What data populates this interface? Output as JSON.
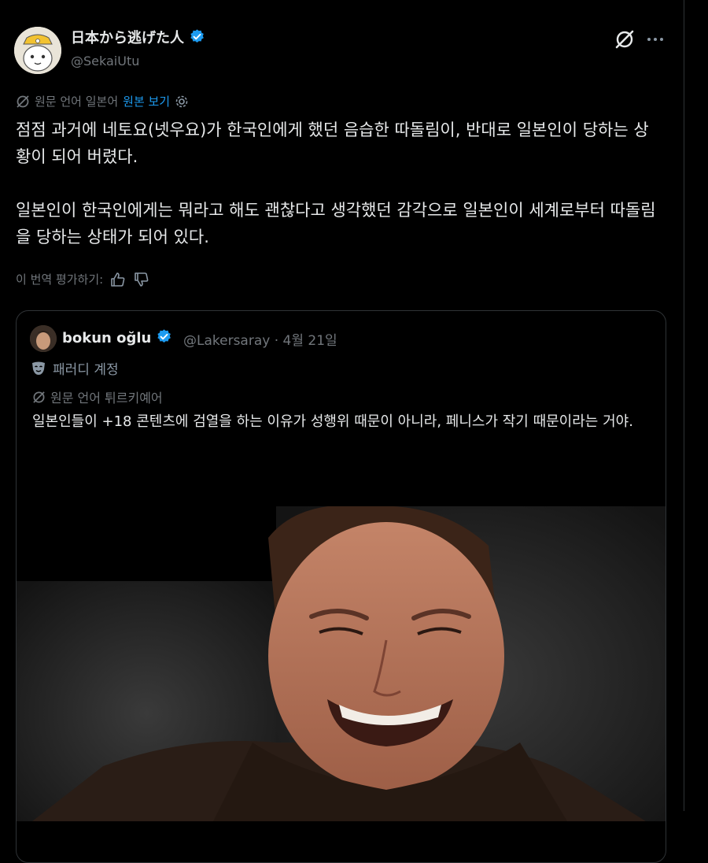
{
  "author": {
    "display_name": "日本から逃げた人",
    "handle": "@SekaiUtu"
  },
  "translation": {
    "source_lang": "원문 언어 일본어",
    "show_original": "원본 보기"
  },
  "post": {
    "paragraphs": [
      "점점 과거에 네토요(넷우요)가 한국인에게 했던 음습한 따돌림이, 반대로 일본인이 당하는 상황이 되어 버렸다.",
      "일본인이 한국인에게는 뭐라고 해도 괜찮다고 생각했던 감각으로 일본인이 세계로부터 따돌림을 당하는 상태가 되어 있다."
    ]
  },
  "rating": {
    "label": "이 번역 평가하기:"
  },
  "quote": {
    "display_name": "bokun oğlu",
    "meta": "@Lakersaray · 4월 21일",
    "parody_label": "패러디 계정",
    "source_lang": "원문 언어 튀르키예어",
    "text": "일본인들이 +18 콘텐츠에 검열을 하는 이유가 성행위 때문이 아니라, 페니스가 작기 때문이라는 거야."
  },
  "colors": {
    "accent": "#1d9bf0",
    "secondary_text": "#71767b",
    "border": "#2f3336"
  },
  "icons": [
    "verified-badge-icon",
    "grok-icon",
    "more-icon",
    "translate-icon",
    "settings-gear-icon",
    "thumbs-up-icon",
    "thumbs-down-icon",
    "parody-mask-icon"
  ]
}
